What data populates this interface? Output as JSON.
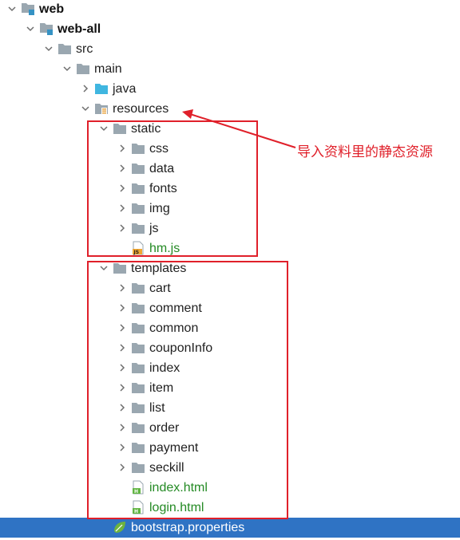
{
  "tree": {
    "items": [
      {
        "label": "web",
        "indent": 0,
        "expander": "open",
        "icon": "module-folder-icon",
        "style": "bold"
      },
      {
        "label": "web-all",
        "indent": 1,
        "expander": "open",
        "icon": "module-folder-icon",
        "style": "bold"
      },
      {
        "label": "src",
        "indent": 2,
        "expander": "open",
        "icon": "folder-icon",
        "style": "normal"
      },
      {
        "label": "main",
        "indent": 3,
        "expander": "open",
        "icon": "folder-icon",
        "style": "normal"
      },
      {
        "label": "java",
        "indent": 4,
        "expander": "closed",
        "icon": "source-folder-icon",
        "style": "normal"
      },
      {
        "label": "resources",
        "indent": 4,
        "expander": "open",
        "icon": "resources-folder-icon",
        "style": "normal"
      },
      {
        "label": "static",
        "indent": 5,
        "expander": "open",
        "icon": "folder-icon",
        "style": "normal"
      },
      {
        "label": "css",
        "indent": 6,
        "expander": "closed",
        "icon": "folder-icon",
        "style": "normal"
      },
      {
        "label": "data",
        "indent": 6,
        "expander": "closed",
        "icon": "folder-icon",
        "style": "normal"
      },
      {
        "label": "fonts",
        "indent": 6,
        "expander": "closed",
        "icon": "folder-icon",
        "style": "normal"
      },
      {
        "label": "img",
        "indent": 6,
        "expander": "closed",
        "icon": "folder-icon",
        "style": "normal"
      },
      {
        "label": "js",
        "indent": 6,
        "expander": "closed",
        "icon": "folder-icon",
        "style": "normal"
      },
      {
        "label": "hm.js",
        "indent": 6,
        "expander": "none",
        "icon": "js-file-icon",
        "style": "green"
      },
      {
        "label": "templates",
        "indent": 5,
        "expander": "open",
        "icon": "folder-icon",
        "style": "normal"
      },
      {
        "label": "cart",
        "indent": 6,
        "expander": "closed",
        "icon": "folder-icon",
        "style": "normal"
      },
      {
        "label": "comment",
        "indent": 6,
        "expander": "closed",
        "icon": "folder-icon",
        "style": "normal"
      },
      {
        "label": "common",
        "indent": 6,
        "expander": "closed",
        "icon": "folder-icon",
        "style": "normal"
      },
      {
        "label": "couponInfo",
        "indent": 6,
        "expander": "closed",
        "icon": "folder-icon",
        "style": "normal"
      },
      {
        "label": "index",
        "indent": 6,
        "expander": "closed",
        "icon": "folder-icon",
        "style": "normal"
      },
      {
        "label": "item",
        "indent": 6,
        "expander": "closed",
        "icon": "folder-icon",
        "style": "normal"
      },
      {
        "label": "list",
        "indent": 6,
        "expander": "closed",
        "icon": "folder-icon",
        "style": "normal"
      },
      {
        "label": "order",
        "indent": 6,
        "expander": "closed",
        "icon": "folder-icon",
        "style": "normal"
      },
      {
        "label": "payment",
        "indent": 6,
        "expander": "closed",
        "icon": "folder-icon",
        "style": "normal"
      },
      {
        "label": "seckill",
        "indent": 6,
        "expander": "closed",
        "icon": "folder-icon",
        "style": "normal"
      },
      {
        "label": "index.html",
        "indent": 6,
        "expander": "none",
        "icon": "html-file-icon",
        "style": "green"
      },
      {
        "label": "login.html",
        "indent": 6,
        "expander": "none",
        "icon": "html-file-icon",
        "style": "green"
      },
      {
        "label": "bootstrap.properties",
        "indent": 5,
        "expander": "none",
        "icon": "spring-properties-icon",
        "style": "selected"
      }
    ]
  },
  "annotation": {
    "text": "导入资料里的静态资源",
    "color": "#e0202a"
  },
  "colors": {
    "folder": "#9aa7b0",
    "selection": "#2f73c4",
    "file_green": "#248a24",
    "annotation_red": "#e0202a",
    "source_folder": "#40b6e0",
    "module_square": "#3592c4"
  }
}
